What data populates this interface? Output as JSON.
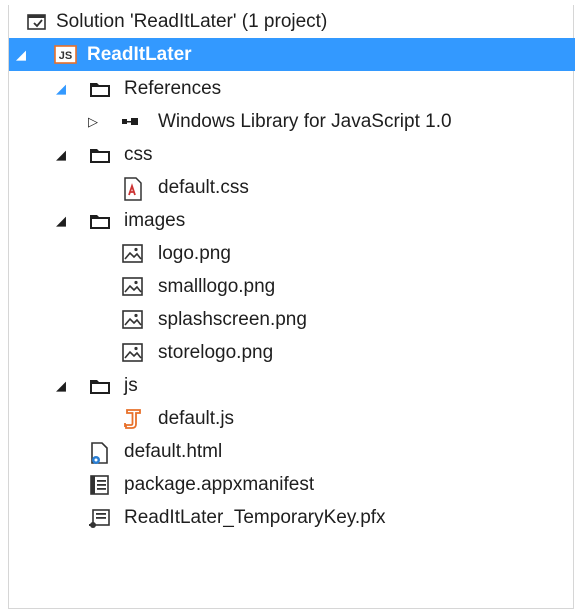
{
  "tree": {
    "solution": {
      "label": "Solution 'ReadItLater' (1 project)"
    },
    "project": {
      "label": "ReadItLater"
    },
    "references": {
      "label": "References",
      "winjs": {
        "label": "Windows Library for JavaScript 1.0"
      }
    },
    "css": {
      "label": "css",
      "default_css": {
        "label": "default.css"
      }
    },
    "images": {
      "label": "images",
      "files": [
        {
          "label": "logo.png"
        },
        {
          "label": "smalllogo.png"
        },
        {
          "label": "splashscreen.png"
        },
        {
          "label": "storelogo.png"
        }
      ]
    },
    "js": {
      "label": "js",
      "default_js": {
        "label": "default.js"
      }
    },
    "default_html": {
      "label": "default.html"
    },
    "manifest": {
      "label": "package.appxmanifest"
    },
    "key": {
      "label": "ReadItLater_TemporaryKey.pfx"
    }
  },
  "colors": {
    "selection": "#3399ff",
    "text": "#1e1e1e",
    "js_accent": "#e8702a",
    "css_accent": "#cc3333"
  },
  "icons": {
    "solution": "solution-icon",
    "project": "js-project-icon",
    "folder": "folder-icon",
    "reference": "reference-icon",
    "css_file": "css-file-icon",
    "image_file": "image-file-icon",
    "js_file": "js-file-icon",
    "html_file": "html-file-icon",
    "manifest_file": "manifest-file-icon",
    "key_file": "key-file-icon"
  }
}
